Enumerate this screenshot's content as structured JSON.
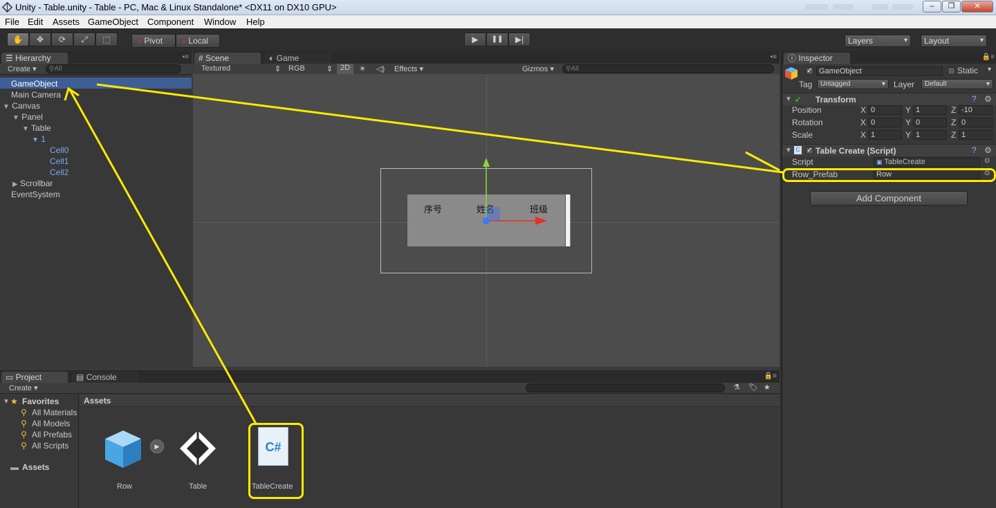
{
  "window": {
    "title": "Unity - Table.unity - Table - PC, Mac & Linux Standalone* <DX11 on DX10 GPU>",
    "minimize": "–",
    "restore": "❐",
    "close": "✕"
  },
  "menubar": {
    "items": [
      "File",
      "Edit",
      "Assets",
      "GameObject",
      "Component",
      "Window",
      "Help"
    ]
  },
  "toolbar": {
    "tools": [
      "✋",
      "✥",
      "⟳",
      "⤢",
      "⬚"
    ],
    "pivot": "Pivot",
    "local": "Local",
    "play": "▶",
    "pause": "❚❚",
    "step": "▶|",
    "layers": "Layers",
    "layout": "Layout"
  },
  "hierarchy": {
    "tab": "Hierarchy",
    "create": "Create",
    "search_placeholder": "All",
    "items": [
      {
        "label": "GameObject",
        "selected": true
      },
      {
        "label": "Main Camera"
      },
      {
        "label": "Canvas"
      },
      {
        "label": "Panel"
      },
      {
        "label": "Table"
      },
      {
        "label": "1"
      },
      {
        "label": "Cell0"
      },
      {
        "label": "Cell1"
      },
      {
        "label": "Cell2"
      },
      {
        "label": "Scrollbar"
      },
      {
        "label": "EventSystem"
      }
    ],
    "expand": "▼",
    "collapse": "▶"
  },
  "scene": {
    "tab": "Scene",
    "game_tab": "Game",
    "render_mode": "Textured",
    "color_mode": "RGB",
    "mode_2d": "2D",
    "effects": "Effects",
    "gizmos": "Gizmos",
    "search_placeholder": "All",
    "headers": [
      "序号",
      "姓名",
      "班级"
    ]
  },
  "inspector": {
    "tab": "Inspector",
    "name": "GameObject",
    "static_label": "Static",
    "tag_label": "Tag",
    "tag_value": "Untagged",
    "layer_label": "Layer",
    "layer_value": "Default",
    "transform": {
      "title": "Transform",
      "position_label": "Position",
      "rotation_label": "Rotation",
      "scale_label": "Scale",
      "axis_x": "X",
      "axis_y": "Y",
      "axis_z": "Z",
      "position": [
        "0",
        "1",
        "-10"
      ],
      "rotation": [
        "0",
        "0",
        "0"
      ],
      "scale": [
        "1",
        "1",
        "1"
      ]
    },
    "script_component": {
      "title": "Table Create (Script)",
      "script_label": "Script",
      "script_value": "TableCreate",
      "row_prefab_label": "Row_Prefab",
      "row_prefab_value": "Row"
    },
    "add_component": "Add Component"
  },
  "project": {
    "tab": "Project",
    "console_tab": "Console",
    "create": "Create",
    "favorites_label": "Favorites",
    "favorites": [
      "All Materials",
      "All Models",
      "All Prefabs",
      "All Scripts"
    ],
    "assets_label": "Assets",
    "assets_header": "Assets",
    "assets": [
      "Row",
      "Table",
      "TableCreate"
    ],
    "script_glyph": "C#"
  }
}
